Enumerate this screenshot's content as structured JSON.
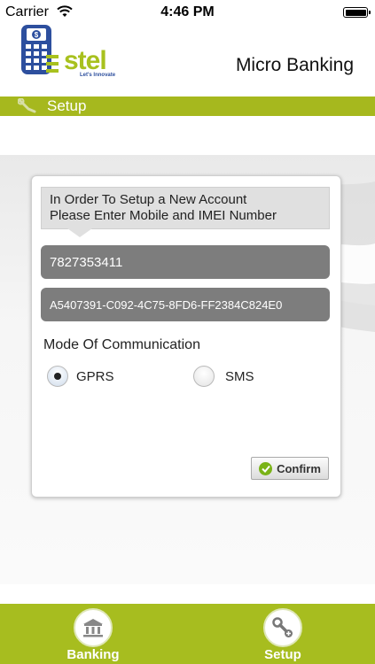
{
  "status_bar": {
    "carrier": "Carrier",
    "time": "4:46 PM"
  },
  "header": {
    "logo_text": "stel",
    "logo_tagline": "Let's Innovate",
    "title": "Micro Banking"
  },
  "section_bar": {
    "label": "Setup"
  },
  "form": {
    "instruction": [
      "In Order To Setup a New Account",
      "Please Enter Mobile and IMEI Number"
    ],
    "mobile_value": "7827353411",
    "imei_value": "A5407391-C092-4C75-8FD6-FF2384C824E0",
    "mode_label": "Mode Of Communication",
    "modes": [
      {
        "label": "GPRS",
        "selected": true
      },
      {
        "label": "SMS",
        "selected": false
      }
    ],
    "confirm_label": "Confirm"
  },
  "tab_bar": {
    "tabs": [
      {
        "label": "Banking",
        "icon": "bank-icon"
      },
      {
        "label": "Setup",
        "icon": "tools-icon"
      }
    ]
  },
  "colors": {
    "accent": "#a6b81e",
    "field_bg": "#7d7d7d",
    "brand_blue": "#2d4f9e"
  }
}
